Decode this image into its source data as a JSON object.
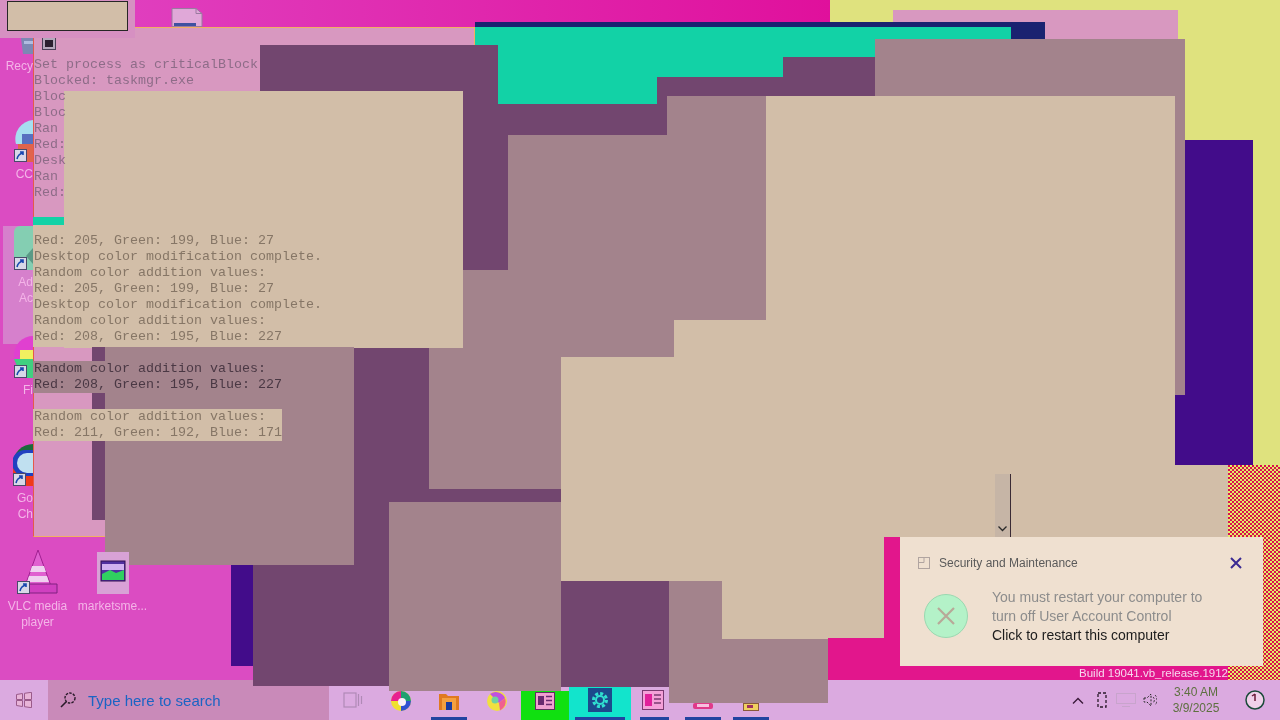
{
  "desktop": {
    "icons": [
      {
        "label": "Recy",
        "shortcut": false,
        "selected": false
      },
      {
        "label": "CC",
        "shortcut": true,
        "selected": false
      },
      {
        "label": "Ad\nAc",
        "shortcut": true,
        "selected": true
      },
      {
        "label": "Fi",
        "shortcut": true,
        "selected": false
      },
      {
        "label": "Go\nCh",
        "shortcut": true,
        "selected": false
      },
      {
        "label": "VLC media player",
        "shortcut": true,
        "selected": false
      },
      {
        "label": "marketsme...",
        "shortcut": false,
        "selected": false
      }
    ]
  },
  "console_window": {
    "groups": [
      {
        "lines": [
          "Set process as criticalBlock",
          "Blocked: taskmgr.exe",
          "Bloc",
          "Bloc",
          "Ran",
          "Red:",
          "Desk",
          "Ran",
          "Red:"
        ]
      },
      {
        "lines": [
          "Red: 205, Green: 199, Blue: 27",
          "Desktop color modification complete.",
          "Random color addition values:",
          "Red: 205, Green: 199, Blue: 27",
          "Desktop color modification complete.",
          "Random color addition values:",
          "Red: 208, Green: 195, Blue: 227"
        ]
      },
      {
        "lines": [
          "Random color addition values:",
          "Red: 208, Green: 195, Blue: 227"
        ]
      },
      {
        "lines": [
          "Random color addition values:",
          "Red: 211, Green: 192, Blue: 171"
        ]
      }
    ]
  },
  "notification": {
    "title": "Security and Maintenance",
    "message": "You must restart your computer to turn off User Account Control",
    "action": "Click to restart this computer"
  },
  "build_text": "Build 19041.vb_release.1912",
  "taskbar": {
    "search": {
      "placeholder": "Type here to search"
    },
    "buttons": [
      {
        "running": false
      },
      {
        "running": false
      },
      {
        "running": true
      },
      {
        "running": false
      },
      {
        "running": false,
        "color": "#10e010"
      },
      {
        "running": true,
        "color": "#12e4cc"
      },
      {
        "running": true
      },
      {
        "running": true
      },
      {
        "running": true
      }
    ],
    "clock": {
      "time": "3:40 AM",
      "date": "3/9/2025"
    }
  }
}
